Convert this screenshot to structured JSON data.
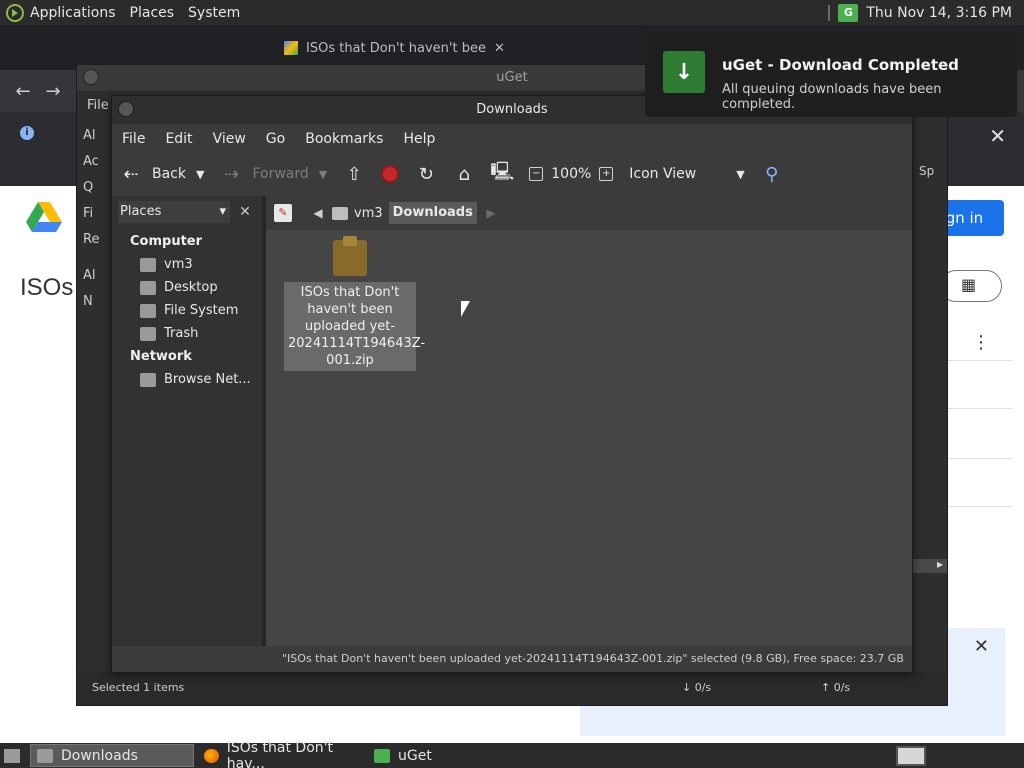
{
  "top_panel": {
    "applications": "Applications",
    "places": "Places",
    "system": "System",
    "clock": "Thu Nov 14,  3:16 PM",
    "tray_uget": "G"
  },
  "browser": {
    "tab_inactive": "ISOs that Don't haven't bee",
    "info_icon": "i",
    "info_close": "✕",
    "signin": "Sign in",
    "title": "ISOs",
    "toast_close": "✕",
    "kebab": "⋮"
  },
  "uget": {
    "title": "uGet",
    "menu_file": "File",
    "side_items": [
      "Al",
      "Ac",
      "Q",
      "Fi",
      "Re",
      "Al",
      "N"
    ],
    "tail": "Sp",
    "status_selected": "Selected 1 items",
    "status_down": "↓  0/s",
    "status_up": "↑  0/s"
  },
  "downloads": {
    "title": "Downloads",
    "menu": [
      "File",
      "Edit",
      "View",
      "Go",
      "Bookmarks",
      "Help"
    ],
    "toolbar": {
      "back": "Back",
      "forward": "Forward",
      "zoom": "100%",
      "view_mode": "Icon View"
    },
    "places": {
      "selector": "Places",
      "computer": "Computer",
      "items": [
        "vm3",
        "Desktop",
        "File System",
        "Trash"
      ],
      "network": "Network",
      "network_items": [
        "Browse Net..."
      ]
    },
    "pathbar": {
      "parent": "vm3",
      "current": "Downloads"
    },
    "file": {
      "line1": "ISOs that Don't",
      "line2": "haven't been",
      "line3": "uploaded yet-",
      "line4": "20241114T194643Z-",
      "line5": "001.zip"
    },
    "statusbar": "\"ISOs that Don't haven't been uploaded yet-20241114T194643Z-001.zip\" selected (9.8 GB), Free space: 23.7 GB"
  },
  "notification": {
    "title": "uGet - Download Completed",
    "body": "All queuing downloads have been completed.",
    "icon_glyph": "↓"
  },
  "taskbar": {
    "items": [
      "Downloads",
      "ISOs that Don't hav...",
      "uGet"
    ]
  }
}
